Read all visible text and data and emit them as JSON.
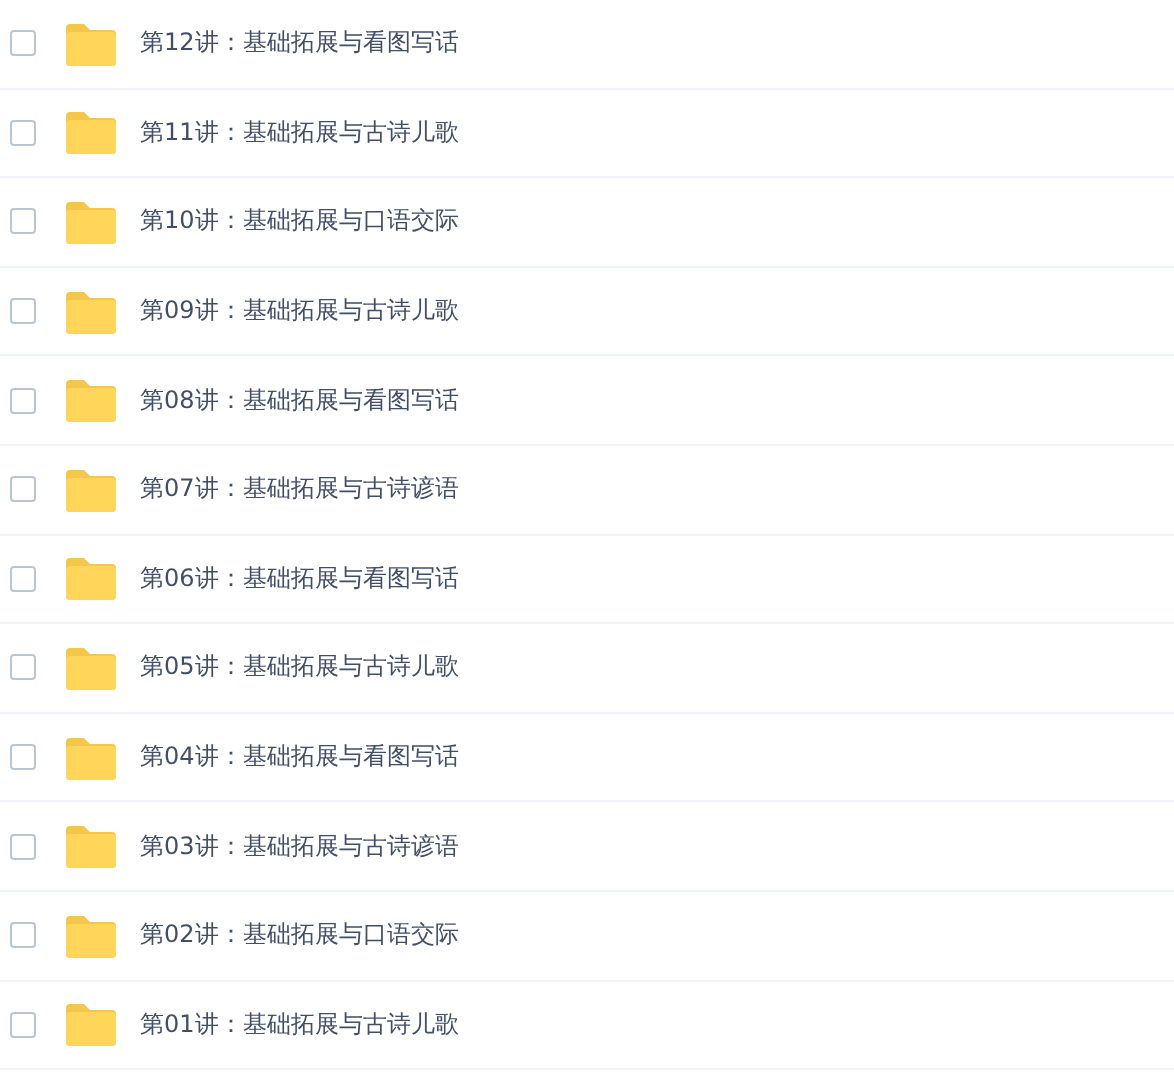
{
  "files": [
    {
      "name": "第12讲：基础拓展与看图写话",
      "checked": false
    },
    {
      "name": "第11讲：基础拓展与古诗儿歌",
      "checked": false
    },
    {
      "name": "第10讲：基础拓展与口语交际",
      "checked": false
    },
    {
      "name": "第09讲：基础拓展与古诗儿歌",
      "checked": false
    },
    {
      "name": "第08讲：基础拓展与看图写话",
      "checked": false
    },
    {
      "name": "第07讲：基础拓展与古诗谚语",
      "checked": false
    },
    {
      "name": "第06讲：基础拓展与看图写话",
      "checked": false
    },
    {
      "name": "第05讲：基础拓展与古诗儿歌",
      "checked": false
    },
    {
      "name": "第04讲：基础拓展与看图写话",
      "checked": false
    },
    {
      "name": "第03讲：基础拓展与古诗谚语",
      "checked": false
    },
    {
      "name": "第02讲：基础拓展与口语交际",
      "checked": false
    },
    {
      "name": "第01讲：基础拓展与古诗儿歌",
      "checked": false
    }
  ]
}
